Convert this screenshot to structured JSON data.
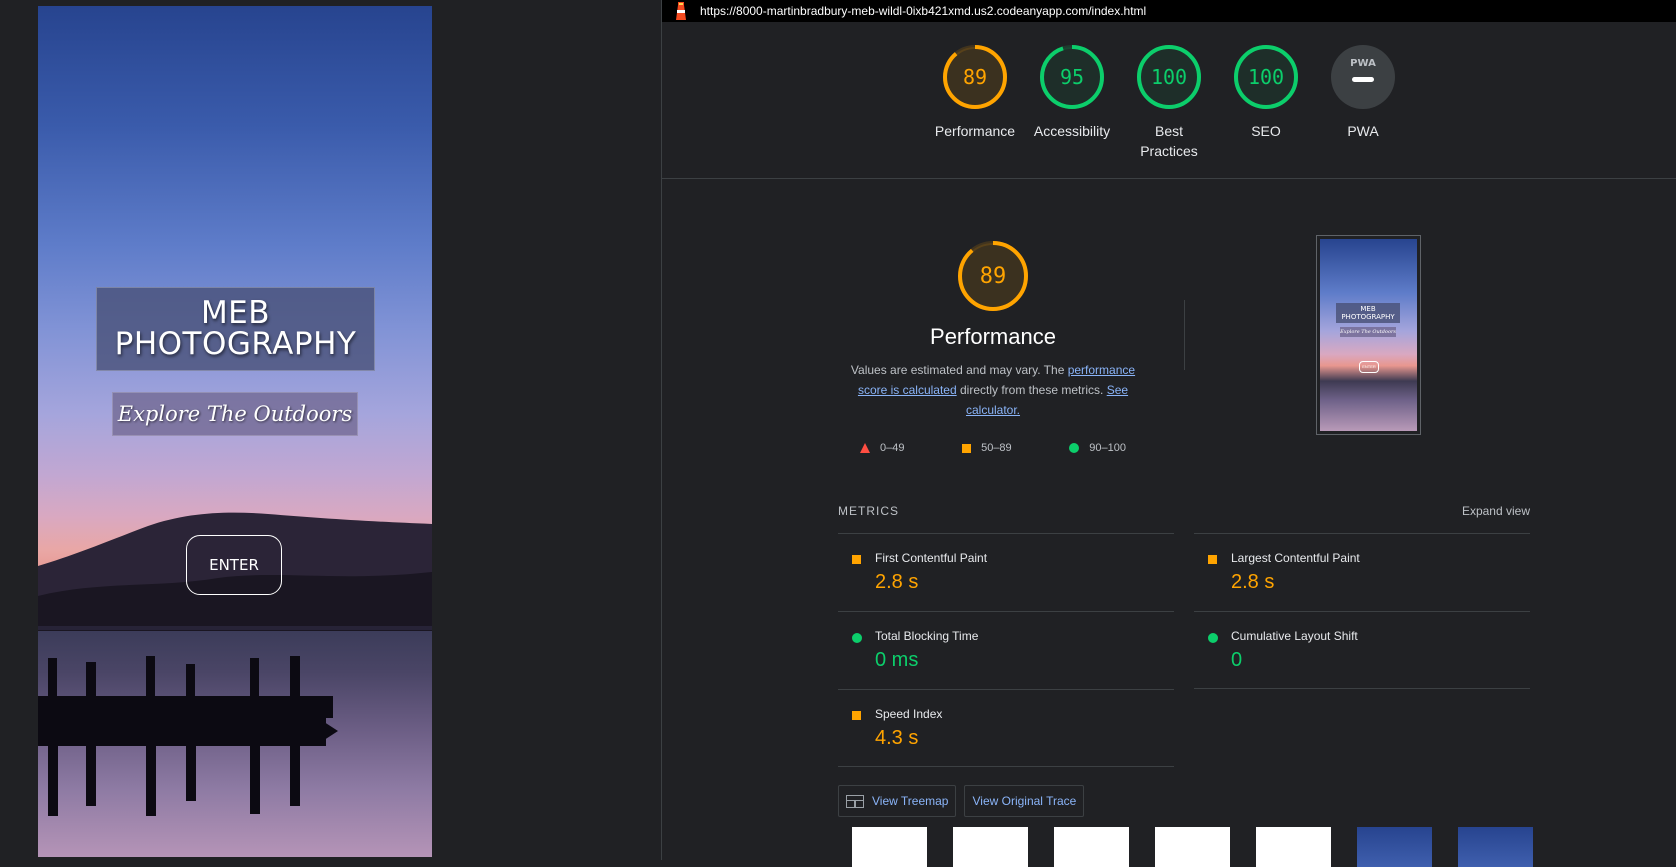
{
  "preview": {
    "site_title": "MEB\nPHOTOGRAPHY",
    "tagline": "Explore The Outdoors",
    "enter_label": "ENTER"
  },
  "report": {
    "url": "https://8000-martinbradbury-meb-wildl-0ixb421xmd.us2.codeanyapp.com/index.html",
    "gauges": [
      {
        "score": "89",
        "label": "Performance",
        "color": "#ffa400",
        "fraction": 0.89
      },
      {
        "score": "95",
        "label": "Accessibility",
        "color": "#0cce6b",
        "fraction": 0.95
      },
      {
        "score": "100",
        "label": "Best\nPractices",
        "color": "#0cce6b",
        "fraction": 1.0
      },
      {
        "score": "100",
        "label": "SEO",
        "color": "#0cce6b",
        "fraction": 1.0
      },
      {
        "score": "PWA",
        "label": "PWA",
        "color": "#9aa0a6",
        "fraction": 0
      }
    ],
    "performance": {
      "score": "89",
      "title": "Performance",
      "desc_1": "Values are estimated and may vary. The ",
      "desc_link_1": "performance score is calculated",
      "desc_2": " directly from these metrics. ",
      "desc_link_2": "See calculator.",
      "legend": {
        "fail": "0–49",
        "average": "50–89",
        "pass": "90–100"
      }
    },
    "thumbnail": {
      "title": "MEB\nPHOTOGRAPHY",
      "tagline": "Explore The Outdoors",
      "enter": "ENTER"
    },
    "metrics": {
      "heading": "METRICS",
      "expand": "Expand view",
      "items": [
        {
          "name": "First Contentful Paint",
          "value": "2.8 s",
          "status": "average"
        },
        {
          "name": "Largest Contentful Paint",
          "value": "2.8 s",
          "status": "average"
        },
        {
          "name": "Total Blocking Time",
          "value": "0 ms",
          "status": "pass"
        },
        {
          "name": "Cumulative Layout Shift",
          "value": "0",
          "status": "pass"
        },
        {
          "name": "Speed Index",
          "value": "4.3 s",
          "status": "average"
        }
      ]
    },
    "buttons": {
      "treemap": "View Treemap",
      "trace": "View Original Trace"
    },
    "colors": {
      "average": "#ffa400",
      "pass": "#0cce6b",
      "fail": "#ff4e42",
      "link": "#8ab4f8"
    }
  }
}
